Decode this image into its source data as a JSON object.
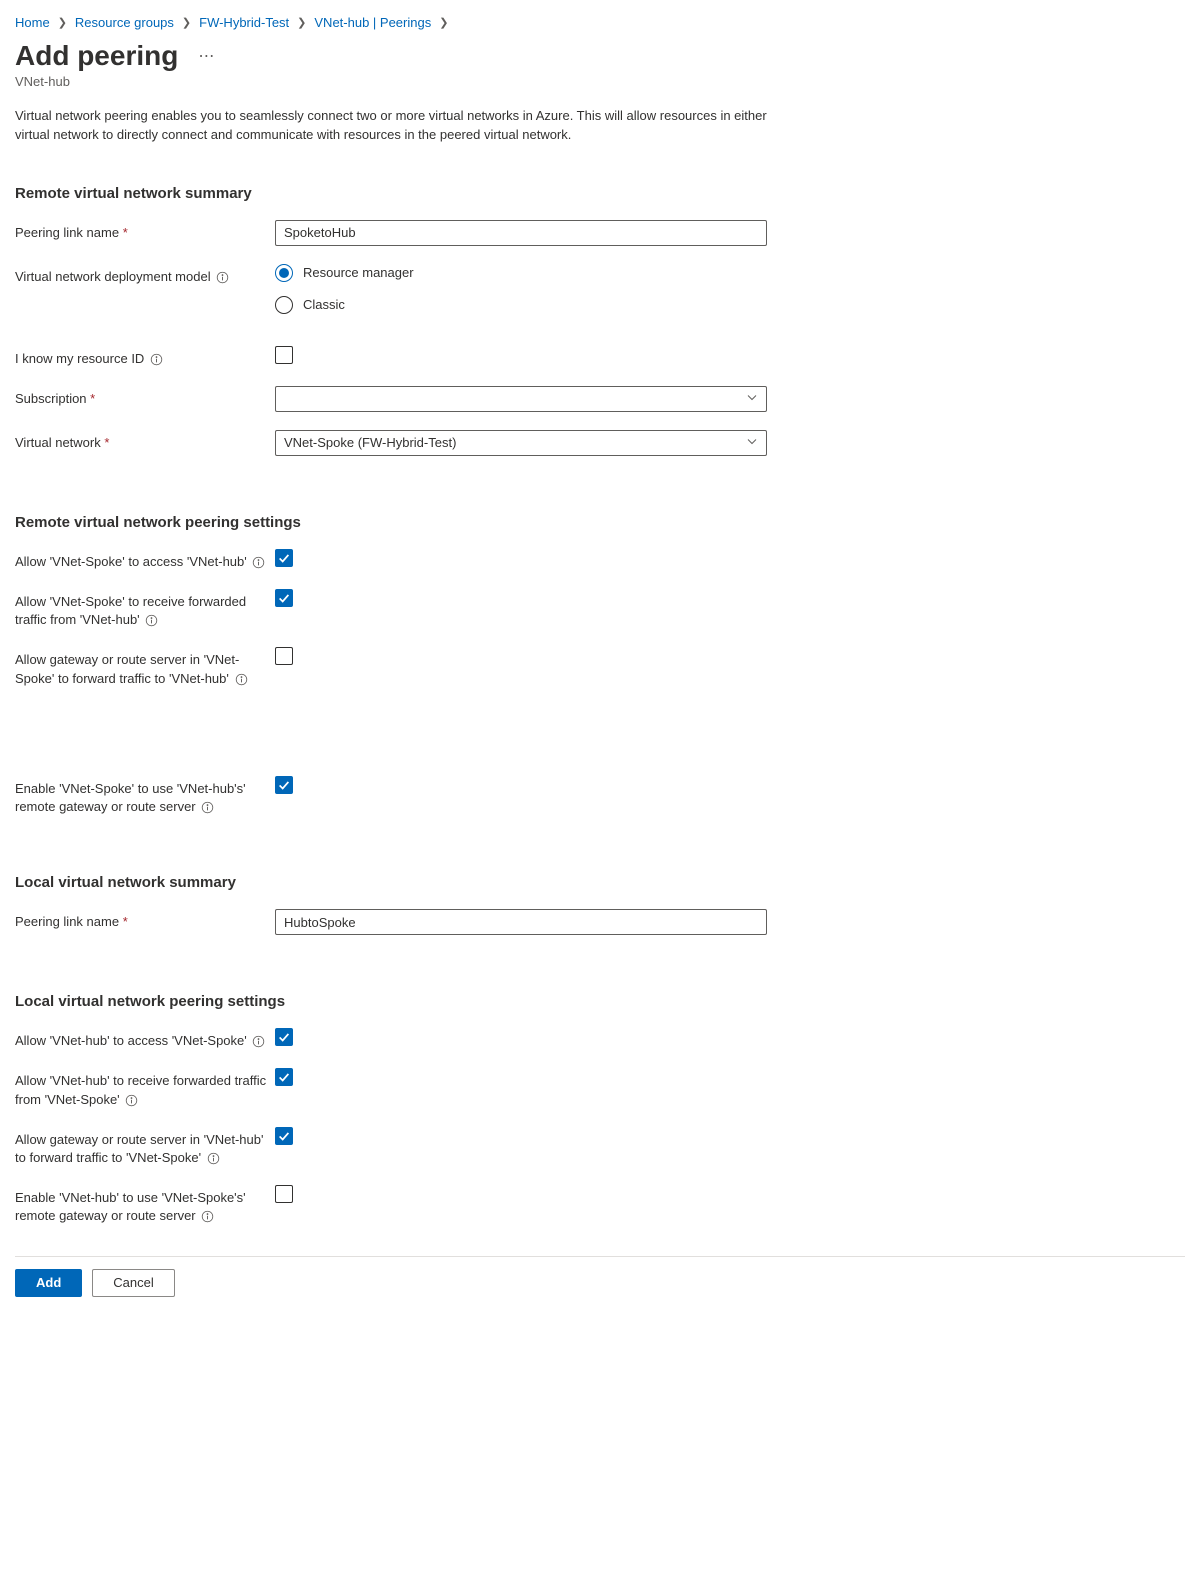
{
  "breadcrumb": [
    {
      "label": "Home"
    },
    {
      "label": "Resource groups"
    },
    {
      "label": "FW-Hybrid-Test"
    },
    {
      "label": "VNet-hub | Peerings"
    }
  ],
  "page": {
    "title": "Add peering",
    "subtitle": "VNet-hub",
    "description": "Virtual network peering enables you to seamlessly connect two or more virtual networks in Azure. This will allow resources in either virtual network to directly connect and communicate with resources in the peered virtual network."
  },
  "remoteSummary": {
    "heading": "Remote virtual network summary",
    "peeringLinkNameLabel": "Peering link name",
    "peeringLinkNameValue": "SpoketoHub",
    "deploymentModelLabel": "Virtual network deployment model",
    "deploymentModelOptions": {
      "resourceManager": "Resource manager",
      "classic": "Classic"
    },
    "deploymentModelSelected": "resourceManager",
    "knowResourceIdLabel": "I know my resource ID",
    "knowResourceIdChecked": false,
    "subscriptionLabel": "Subscription",
    "subscriptionValue": "",
    "virtualNetworkLabel": "Virtual network",
    "virtualNetworkValue": "VNet-Spoke (FW-Hybrid-Test)"
  },
  "remoteSettings": {
    "heading": "Remote virtual network peering settings",
    "allowAccessLabel": "Allow 'VNet-Spoke' to access 'VNet-hub'",
    "allowAccessChecked": true,
    "allowForwardedLabel": "Allow 'VNet-Spoke' to receive forwarded traffic from 'VNet-hub'",
    "allowForwardedChecked": true,
    "allowGatewayLabel": "Allow gateway or route server in 'VNet-Spoke' to forward traffic to 'VNet-hub'",
    "allowGatewayChecked": false,
    "useRemoteGatewayLabel": "Enable 'VNet-Spoke' to use 'VNet-hub's' remote gateway or route server",
    "useRemoteGatewayChecked": true
  },
  "localSummary": {
    "heading": "Local virtual network summary",
    "peeringLinkNameLabel": "Peering link name",
    "peeringLinkNameValue": "HubtoSpoke"
  },
  "localSettings": {
    "heading": "Local virtual network peering settings",
    "allowAccessLabel": "Allow 'VNet-hub' to access 'VNet-Spoke'",
    "allowAccessChecked": true,
    "allowForwardedLabel": "Allow 'VNet-hub' to receive forwarded traffic from 'VNet-Spoke'",
    "allowForwardedChecked": true,
    "allowGatewayLabel": "Allow gateway or route server in 'VNet-hub' to forward traffic to 'VNet-Spoke'",
    "allowGatewayChecked": true,
    "useRemoteGatewayLabel": "Enable 'VNet-hub' to use 'VNet-Spoke's' remote gateway or route server",
    "useRemoteGatewayChecked": false
  },
  "footer": {
    "add": "Add",
    "cancel": "Cancel"
  }
}
